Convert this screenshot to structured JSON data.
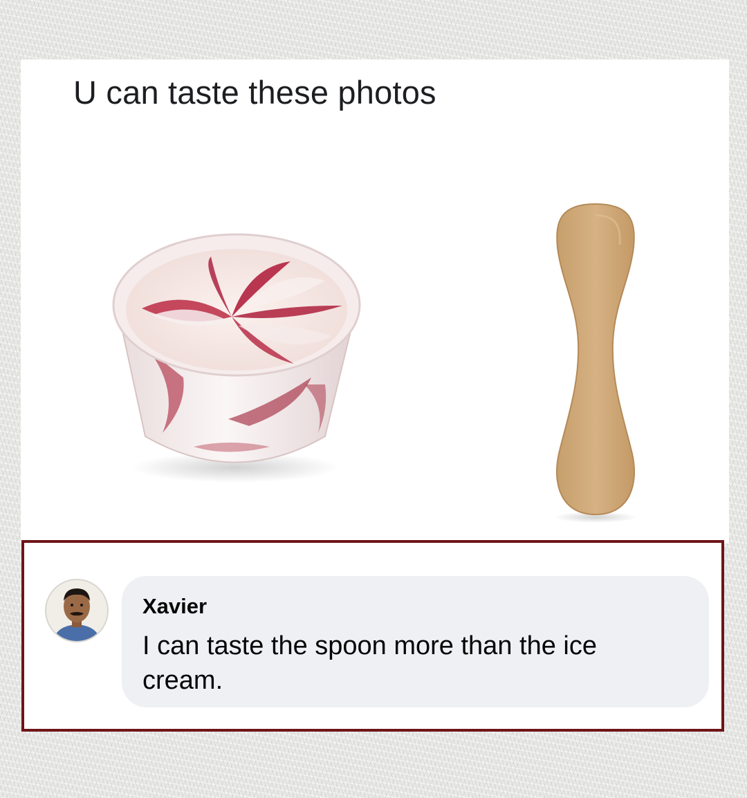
{
  "post": {
    "caption": "U can taste these photos",
    "images": {
      "left": "ice-cream-cup",
      "right": "wooden-spoon"
    }
  },
  "comment": {
    "author": "Xavier",
    "text": "I can taste the spoon more than the ice cream.",
    "highlight_color": "#6e1518",
    "bubble_color": "#eff0f4"
  }
}
